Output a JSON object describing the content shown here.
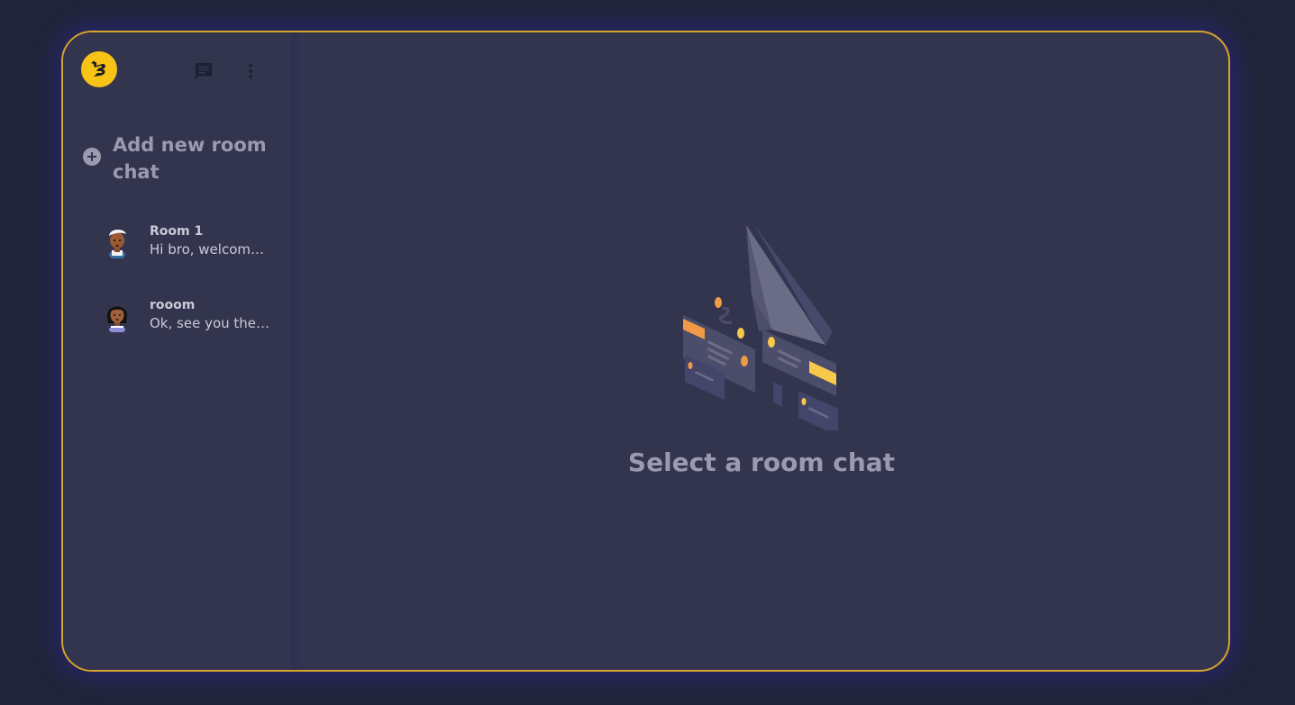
{
  "sidebar": {
    "add_room_label": "Add new room chat",
    "rooms": [
      {
        "name": "Room 1",
        "last_message": "Hi bro, welcome..."
      },
      {
        "name": "rooom",
        "last_message": "Ok, see you the ..."
      }
    ]
  },
  "main": {
    "empty_state_title": "Select a room chat"
  },
  "icons": {
    "logo": "app-logo",
    "new_chat": "chat-bubble-icon",
    "menu": "more-vertical-icon",
    "add": "plus-circle-icon"
  },
  "colors": {
    "background": "#22243a",
    "panel": "#33354f",
    "border_accent": "#d6a42a",
    "logo_yellow": "#f7c316",
    "muted_text": "#9a9bae"
  }
}
